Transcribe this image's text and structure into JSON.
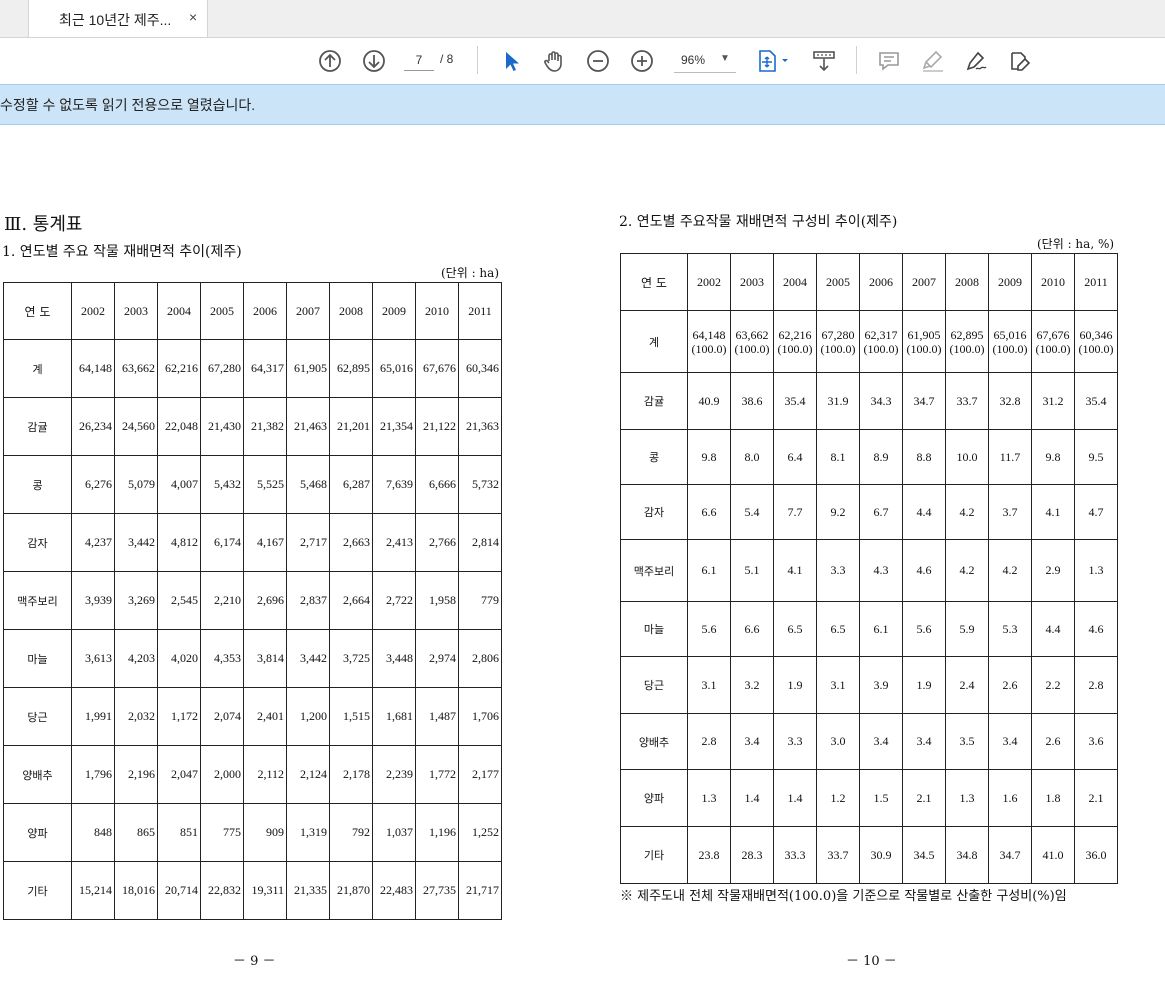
{
  "tab": {
    "title": "최근 10년간 제주...",
    "close": "×"
  },
  "toolbar": {
    "page_current": "7",
    "page_total": "/ 8",
    "zoom": "96%",
    "icons": [
      "scroll-up-icon",
      "scroll-down-icon",
      "select-cursor-icon",
      "hand-tool-icon",
      "zoom-out-icon",
      "zoom-in-icon",
      "fit-page-icon",
      "scroll-mode-icon",
      "comment-icon",
      "highlight-icon",
      "sign-icon",
      "edit-pdf-icon"
    ]
  },
  "notice": "수정할 수 없도록 읽기 전용으로 열렸습니다.",
  "page9": {
    "section": "Ⅲ. 통계표",
    "title": "1. 연도별 주요 작물 재배면적 추이(제주)",
    "unit": "(단위 : ha)",
    "corner": "연 도",
    "years": [
      "2002",
      "2003",
      "2004",
      "2005",
      "2006",
      "2007",
      "2008",
      "2009",
      "2010",
      "2011"
    ],
    "rows": [
      {
        "label": "계",
        "values": [
          "64,148",
          "63,662",
          "62,216",
          "67,280",
          "64,317",
          "61,905",
          "62,895",
          "65,016",
          "67,676",
          "60,346"
        ]
      },
      {
        "label": "감귤",
        "values": [
          "26,234",
          "24,560",
          "22,048",
          "21,430",
          "21,382",
          "21,463",
          "21,201",
          "21,354",
          "21,122",
          "21,363"
        ]
      },
      {
        "label": "콩",
        "values": [
          "6,276",
          "5,079",
          "4,007",
          "5,432",
          "5,525",
          "5,468",
          "6,287",
          "7,639",
          "6,666",
          "5,732"
        ]
      },
      {
        "label": "감자",
        "values": [
          "4,237",
          "3,442",
          "4,812",
          "6,174",
          "4,167",
          "2,717",
          "2,663",
          "2,413",
          "2,766",
          "2,814"
        ]
      },
      {
        "label": "맥주보리",
        "values": [
          "3,939",
          "3,269",
          "2,545",
          "2,210",
          "2,696",
          "2,837",
          "2,664",
          "2,722",
          "1,958",
          "779"
        ]
      },
      {
        "label": "마늘",
        "values": [
          "3,613",
          "4,203",
          "4,020",
          "4,353",
          "3,814",
          "3,442",
          "3,725",
          "3,448",
          "2,974",
          "2,806"
        ]
      },
      {
        "label": "당근",
        "values": [
          "1,991",
          "2,032",
          "1,172",
          "2,074",
          "2,401",
          "1,200",
          "1,515",
          "1,681",
          "1,487",
          "1,706"
        ]
      },
      {
        "label": "양배추",
        "values": [
          "1,796",
          "2,196",
          "2,047",
          "2,000",
          "2,112",
          "2,124",
          "2,178",
          "2,239",
          "1,772",
          "2,177"
        ]
      },
      {
        "label": "양파",
        "values": [
          "848",
          "865",
          "851",
          "775",
          "909",
          "1,319",
          "792",
          "1,037",
          "1,196",
          "1,252"
        ]
      },
      {
        "label": "기타",
        "values": [
          "15,214",
          "18,016",
          "20,714",
          "22,832",
          "19,311",
          "21,335",
          "21,870",
          "22,483",
          "27,735",
          "21,717"
        ]
      }
    ],
    "page_number": "－ 9 －"
  },
  "page10": {
    "title": "2. 연도별 주요작물 재배면적 구성비 추이(제주)",
    "unit": "(단위 : ha, %)",
    "corner": "연 도",
    "years": [
      "2002",
      "2003",
      "2004",
      "2005",
      "2006",
      "2007",
      "2008",
      "2009",
      "2010",
      "2011"
    ],
    "total_label": "계",
    "total_values": [
      "64,148",
      "63,662",
      "62,216",
      "67,280",
      "62,317",
      "61,905",
      "62,895",
      "65,016",
      "67,676",
      "60,346"
    ],
    "total_pct": "(100.0)",
    "rows": [
      {
        "label": "감귤",
        "values": [
          "40.9",
          "38.6",
          "35.4",
          "31.9",
          "34.3",
          "34.7",
          "33.7",
          "32.8",
          "31.2",
          "35.4"
        ]
      },
      {
        "label": "콩",
        "values": [
          "9.8",
          "8.0",
          "6.4",
          "8.1",
          "8.9",
          "8.8",
          "10.0",
          "11.7",
          "9.8",
          "9.5"
        ]
      },
      {
        "label": "감자",
        "values": [
          "6.6",
          "5.4",
          "7.7",
          "9.2",
          "6.7",
          "4.4",
          "4.2",
          "3.7",
          "4.1",
          "4.7"
        ]
      },
      {
        "label": "맥주보리",
        "values": [
          "6.1",
          "5.1",
          "4.1",
          "3.3",
          "4.3",
          "4.6",
          "4.2",
          "4.2",
          "2.9",
          "1.3"
        ]
      },
      {
        "label": "마늘",
        "values": [
          "5.6",
          "6.6",
          "6.5",
          "6.5",
          "6.1",
          "5.6",
          "5.9",
          "5.3",
          "4.4",
          "4.6"
        ]
      },
      {
        "label": "당근",
        "values": [
          "3.1",
          "3.2",
          "1.9",
          "3.1",
          "3.9",
          "1.9",
          "2.4",
          "2.6",
          "2.2",
          "2.8"
        ]
      },
      {
        "label": "양배추",
        "values": [
          "2.8",
          "3.4",
          "3.3",
          "3.0",
          "3.4",
          "3.4",
          "3.5",
          "3.4",
          "2.6",
          "3.6"
        ]
      },
      {
        "label": "양파",
        "values": [
          "1.3",
          "1.4",
          "1.4",
          "1.2",
          "1.5",
          "2.1",
          "1.3",
          "1.6",
          "1.8",
          "2.1"
        ]
      },
      {
        "label": "기타",
        "values": [
          "23.8",
          "28.3",
          "33.3",
          "33.7",
          "30.9",
          "34.5",
          "34.8",
          "34.7",
          "41.0",
          "36.0"
        ]
      }
    ],
    "footnote": "※ 제주도내 전체 작물재배면적(100.0)을 기준으로 작물별로 산출한 구성비(%)임",
    "page_number": "－ 10 －"
  }
}
